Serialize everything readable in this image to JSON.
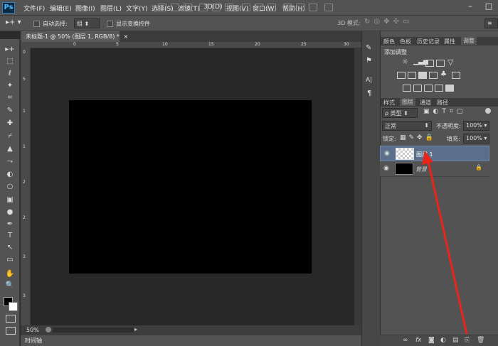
{
  "app": {
    "logo": "Ps",
    "menu": [
      "文件(F)",
      "编辑(E)",
      "图像(I)",
      "图层(L)",
      "文字(Y)",
      "选择(S)",
      "滤镜(T)",
      "3D(D)",
      "视图(V)",
      "窗口(W)",
      "帮助(H)"
    ],
    "window_controls": [
      "–",
      "□"
    ]
  },
  "options_bar": {
    "auto_select_label": "自动选择:",
    "auto_select_value": "组",
    "show_transform_label": "显示变换控件",
    "mode_3d_label": "3D 模式:"
  },
  "document": {
    "tab_title": "未标题-1 @ 50% (图层 1, RGB/8) *",
    "tab_close": "×",
    "zoom": "50%",
    "ruler_top": [
      "0",
      "5",
      "10",
      "15",
      "20",
      "25",
      "30"
    ],
    "ruler_left": [
      "0",
      "5",
      "1",
      "1",
      "2",
      "2",
      "3",
      "3"
    ]
  },
  "timeline": {
    "label": "时间轴"
  },
  "tools": [
    "▸+",
    "⬚",
    "ℓ",
    "✦",
    "⌗",
    "✎",
    "✚",
    "⌿",
    "▲",
    "⤳",
    "◐",
    "⎔",
    "▣",
    "✋",
    "●",
    "✒",
    "T",
    "↖",
    "▭",
    "✋",
    "🔍"
  ],
  "right_strip": [
    "✎",
    "⚑",
    "A|",
    "¶"
  ],
  "adjustments_panel": {
    "tabs": [
      "颜色",
      "色板",
      "历史记录",
      "属性",
      "调整"
    ],
    "active_tab": "调整",
    "title": "添加调整"
  },
  "layers_panel": {
    "tabs": [
      "样式",
      "图层",
      "通道",
      "路径"
    ],
    "active_tab": "图层",
    "filter_label": "ρ 类型",
    "blend_mode": "正常",
    "opacity_label": "不透明度:",
    "opacity_value": "100%",
    "lock_label": "锁定:",
    "fill_label": "填充:",
    "fill_value": "100%",
    "layers": [
      {
        "name": "图层 1",
        "selected": true,
        "thumb": "transparent"
      },
      {
        "name": "背景",
        "selected": false,
        "thumb": "black",
        "locked": true
      }
    ],
    "bottom_icons": [
      "∞",
      "fx",
      "◙",
      "◐",
      "▤",
      "⎘",
      "🗑"
    ]
  },
  "colors": {
    "ui_dark": "#535353",
    "canvas_bg": "#282828",
    "selected_layer": "#5b6f8a",
    "arrow_red": "#e8251a"
  }
}
